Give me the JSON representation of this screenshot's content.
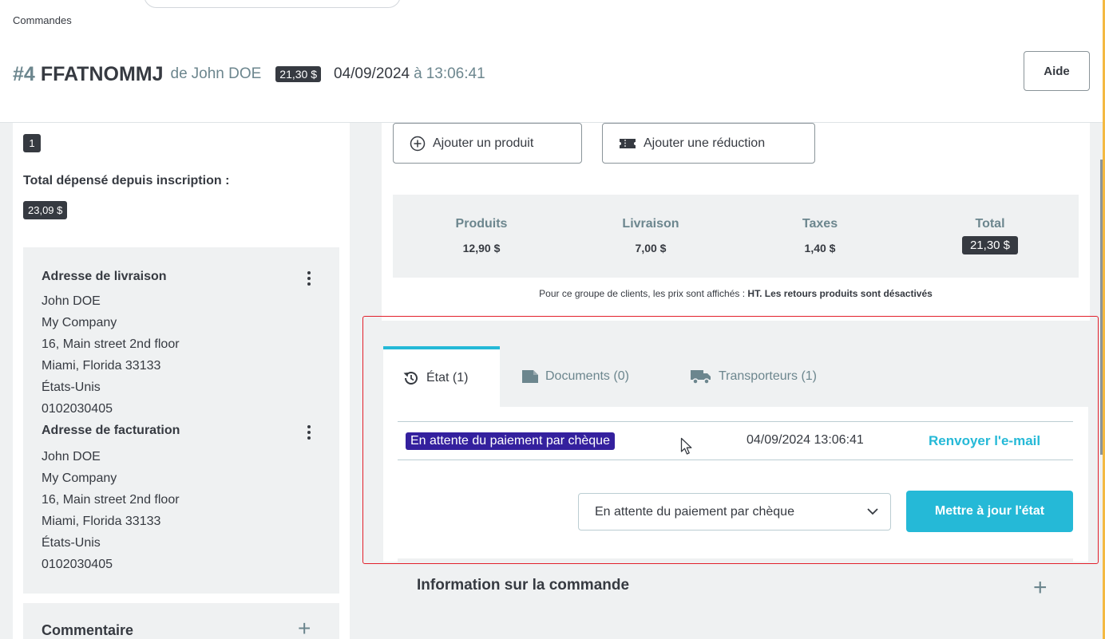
{
  "breadcrumb": "Commandes",
  "order": {
    "number": "#4",
    "reference": "FFATNOMMJ",
    "of_label": "de",
    "customer": "John DOE",
    "total_badge": "21,30 $",
    "date": "04/09/2024",
    "at_label": "à",
    "time": "13:06:41"
  },
  "toolbar": {
    "help_label": "Aide"
  },
  "customer_panel": {
    "orders_count": "1",
    "spent_label": "Total dépensé depuis inscription :",
    "spent_value": "23,09 $",
    "delivery_address": {
      "title": "Adresse de livraison",
      "lines": [
        "John DOE",
        "My Company",
        "16, Main street 2nd floor",
        "Miami, Florida 33133",
        "États-Unis",
        "0102030405"
      ]
    },
    "invoice_address": {
      "title": "Adresse de facturation",
      "lines": [
        "John DOE",
        "My Company",
        "16, Main street 2nd floor",
        "Miami, Florida 33133",
        "États-Unis",
        "0102030405"
      ]
    },
    "comment_title": "Commentaire"
  },
  "products": {
    "add_product_label": "Ajouter un produit",
    "add_discount_label": "Ajouter une réduction"
  },
  "totals": {
    "products_label": "Produits",
    "products_value": "12,90 $",
    "shipping_label": "Livraison",
    "shipping_value": "7,00 $",
    "taxes_label": "Taxes",
    "taxes_value": "1,40 $",
    "total_label": "Total",
    "total_value": "21,30 $"
  },
  "price_note": {
    "prefix": "Pour ce groupe de clients, les prix sont affichés :",
    "tax_mode": "HT.",
    "returns": "Les retours produits sont désactivés"
  },
  "tabs": {
    "status_label": "État (1)",
    "documents_label": "Documents (0)",
    "carriers_label": "Transporteurs (1)"
  },
  "history": {
    "status": "En attente du paiement par chèque",
    "status_color": "#34209e",
    "date": "04/09/2024 13:06:41",
    "resend_label": "Renvoyer l'e-mail"
  },
  "status_update": {
    "selected": "En attente du paiement par chèque",
    "button_label": "Mettre à jour l'état"
  },
  "order_info": {
    "title": "Information sur la commande"
  },
  "colors": {
    "accent": "#25b9d7",
    "dark": "#363a41",
    "highlight": "#e2202b"
  },
  "icons": {
    "add_product": "plus-circle-icon",
    "add_discount": "ticket-icon",
    "status_tab": "history-icon",
    "documents_tab": "document-icon",
    "carriers_tab": "truck-icon",
    "select": "chevron-down-icon",
    "cursor": "mouse-pointer-icon"
  }
}
